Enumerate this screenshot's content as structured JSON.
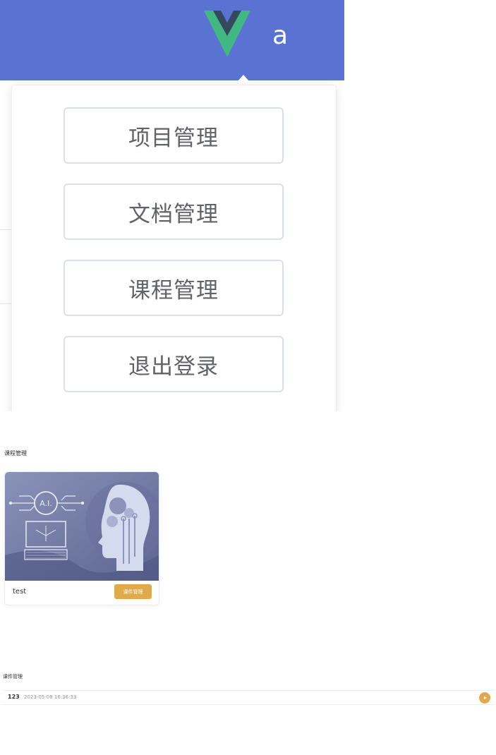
{
  "header": {
    "user_initial": "a",
    "logo_icon": "vue-logo-icon",
    "background_color": "#5a72d2"
  },
  "dropdown": {
    "items": [
      {
        "label": "项目管理"
      },
      {
        "label": "文档管理"
      },
      {
        "label": "课程管理"
      },
      {
        "label": "退出登录"
      }
    ]
  },
  "courses": {
    "title": "课程管理",
    "items": [
      {
        "name": "test",
        "action_label": "课件管理",
        "cover_icon": "ai-brain-cover-image"
      }
    ]
  },
  "lessons": {
    "title": "课件管理",
    "items": [
      {
        "name": "123",
        "time": "2023-05-08 16:36:33",
        "action_icon": "play-icon"
      }
    ]
  },
  "colors": {
    "accent": "#e0a94c",
    "text": "#303133",
    "muted": "#909399"
  }
}
